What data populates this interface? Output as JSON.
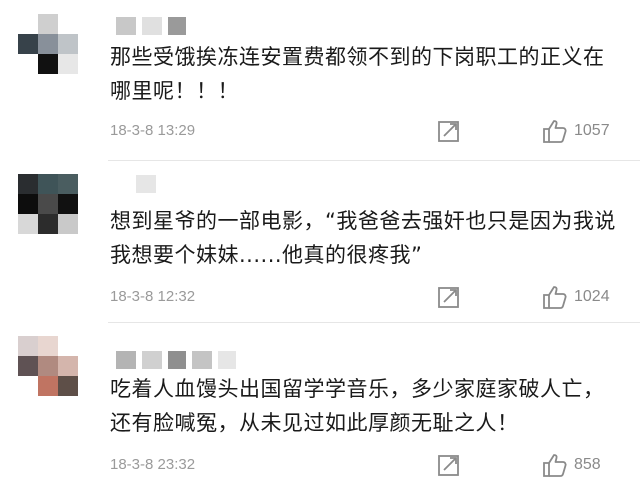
{
  "comments": [
    {
      "text": "那些受饿挨冻连安置费都领不到的下岗职工的正义在哪里呢！！！",
      "time": "18-3-8 13:29",
      "likes": "1057",
      "avatar_colors": [
        "#ffffff",
        "#cfcfcf",
        "#ffffff",
        "#37424a",
        "#88909a",
        "#bfc4c8",
        "#ffffff",
        "#111111",
        "#e7e7e7"
      ],
      "username_blocks": [
        "#c8c8c8",
        "#e0e0e0",
        "#9a9a9a"
      ]
    },
    {
      "text": "想到星爷的一部电影，“我爸爸去强奸也只是因为我说我想要个妹妹......他真的很疼我”",
      "time": "18-3-8 12:32",
      "likes": "1024",
      "avatar_colors": [
        "#2a2d30",
        "#3f5458",
        "#4a5d60",
        "#0d0d0d",
        "#4a4a4a",
        "#111111",
        "#d8d8d8",
        "#2c2c2c",
        "#c9c9c9"
      ],
      "username_blocks": [
        "#e6e6e6"
      ]
    },
    {
      "text": "吃着人血馒头出国留学学音乐，多少家庭家破人亡，还有脸喊冤，从未见过如此厚颜无耻之人！",
      "time": "18-3-8 23:32",
      "likes": "858",
      "avatar_colors": [
        "#d9cfcf",
        "#e8d6d0",
        "#ffffff",
        "#5f5254",
        "#b08a80",
        "#d4b5ac",
        "#ffffff",
        "#c07462",
        "#5e4f48"
      ],
      "username_blocks": [
        "#b4b4b4",
        "#d0d0d0",
        "#8f8f8f",
        "#c4c4c4",
        "#e6e6e6"
      ]
    }
  ],
  "colors": {
    "text": "#1a1a1a",
    "meta": "#9a9a9a",
    "divider": "#e6e6e6"
  },
  "icons": {
    "reply": "reply-edit-icon",
    "like": "thumbs-up-icon"
  }
}
